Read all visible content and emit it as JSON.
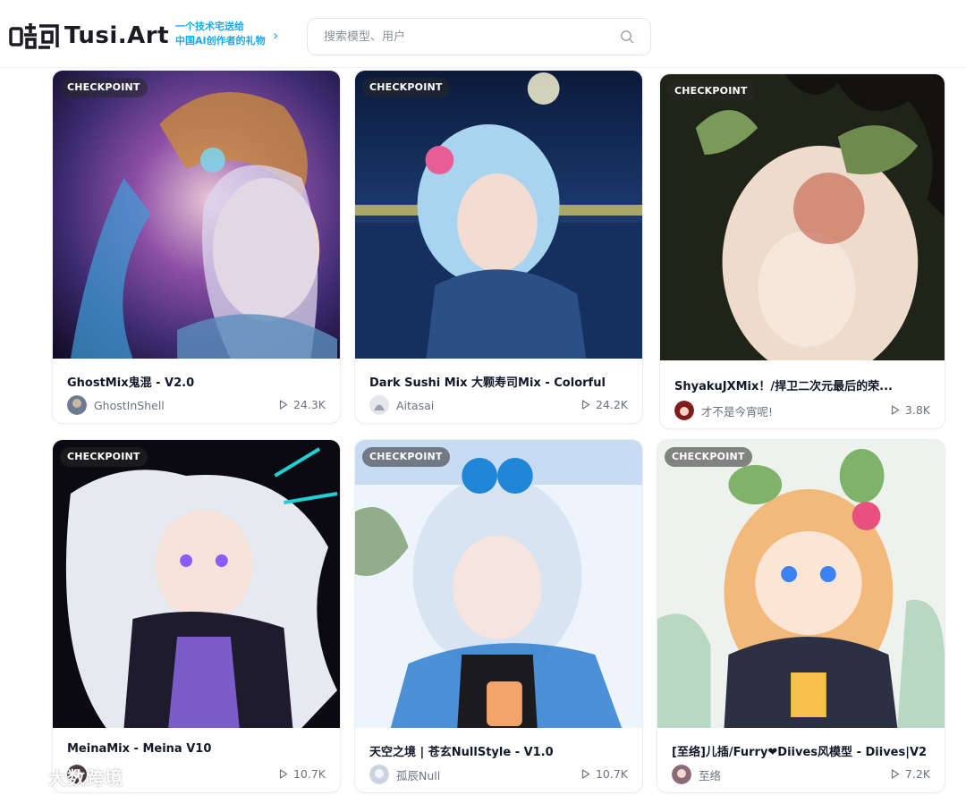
{
  "header": {
    "brand": "Tusi.Art",
    "slogan_line1": "一个技术宅送给",
    "slogan_line2": "中国AI创作者的礼物",
    "search_placeholder": "搜索模型、用户"
  },
  "cards": [
    {
      "badge": "CHECKPOINT",
      "title": "GhostMix鬼混 - V2.0",
      "author": "GhostInShell",
      "runs": "24.3K"
    },
    {
      "badge": "CHECKPOINT",
      "title": "Dark Sushi Mix 大颗寿司Mix - Colorful",
      "author": "Aitasai",
      "runs": "24.2K"
    },
    {
      "badge": "CHECKPOINT",
      "title": "ShyakuJXMix！/捍卫二次元最后的荣...",
      "author": "才不是今宵呢!",
      "runs": "3.8K"
    },
    {
      "badge": "CHECKPOINT",
      "title": "MeinaMix - Meina V10",
      "author": "",
      "runs": "10.7K"
    },
    {
      "badge": "CHECKPOINT",
      "title": "天空之境 | 苍玄NullStyle - V1.0",
      "author": "孤辰Null",
      "runs": "10.7K"
    },
    {
      "badge": "CHECKPOINT",
      "title": "[至络]儿插/Furry❤Diives风模型 - Diives|V2",
      "author": "至络",
      "runs": "7.2K"
    }
  ],
  "watermark": "大数跨境",
  "colors": {
    "accent": "#1aa7ec",
    "text": "#111827",
    "muted": "#6b7280"
  }
}
